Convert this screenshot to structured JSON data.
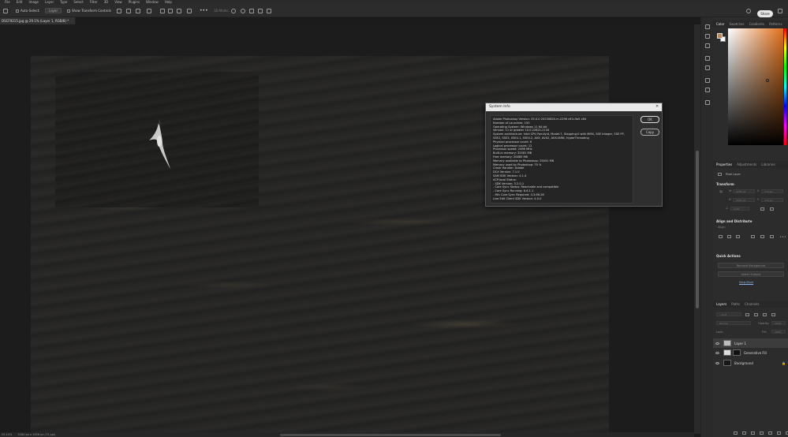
{
  "menubar": {
    "items": [
      "File",
      "Edit",
      "Image",
      "Layer",
      "Type",
      "Select",
      "Filter",
      "3D",
      "View",
      "Plugins",
      "Window",
      "Help"
    ]
  },
  "options_bar": {
    "auto_select_label": "Auto-Select:",
    "auto_select_value": "Layer",
    "show_transform_label": "Show Transform Controls",
    "mode_label": "3D Mode:",
    "share_label": "Share"
  },
  "document": {
    "tab_title": "DSCF9215.jpg @ 29.1% (Layer 1, RGB/8) *"
  },
  "status_bar": {
    "zoom": "29.14%",
    "info": "5184 px x 3456 px (72 ppi)"
  },
  "color_panel": {
    "tabs": [
      "Color",
      "Swatches",
      "Gradients",
      "Patterns"
    ],
    "active_tab": "Color",
    "fg_color": "#b88a5c",
    "bg_color": "#ffffff"
  },
  "properties_panel": {
    "tabs": [
      "Properties",
      "Adjustments",
      "Libraries"
    ],
    "active_tab": "Properties",
    "layer_type": "Pixel Layer",
    "transform_title": "Transform",
    "w_label": "W",
    "w_value": "2281 px",
    "x_label": "X",
    "x_value": "174 px",
    "h_label": "H",
    "h_value": "1521 px",
    "y_label": "Y",
    "y_value": "175 px",
    "angle_value": "0.00°",
    "align_title": "Align and Distribute",
    "align_label": "Align:",
    "quick_actions_title": "Quick Actions",
    "remove_bg_label": "Remove Background",
    "select_subject_label": "Select Subject",
    "view_more_label": "View More"
  },
  "layers_panel": {
    "tabs": [
      "Layers",
      "Paths",
      "Channels"
    ],
    "active_tab": "Layers",
    "kind_placeholder": "Kind",
    "blend_mode": "Normal",
    "opacity_label": "Opacity:",
    "opacity_value": "100%",
    "lock_label": "Lock:",
    "fill_label": "Fill:",
    "fill_value": "100%",
    "layers": [
      {
        "name": "Layer 1",
        "selected": true
      },
      {
        "name": "Generative Fill",
        "selected": false
      },
      {
        "name": "Background",
        "selected": false
      }
    ]
  },
  "dialog": {
    "title": "System Info",
    "ok_label": "OK",
    "copy_label": "Copy",
    "lines": [
      "Adobe Photoshop Version: 25.0.0 20230820.m.2296 c61c3a5  x64",
      "Number of Launches: 150",
      "Operating System: Windows 11 64-bit",
      "Version: 11 or greater 10.0.22621.2134",
      "System architecture: Intel CPU Family:6, Model:7, Stepping:0 with MMX, SSE Integer, SSE FP,",
      "SSE2, SSE3, SSE4.1, SSE4.2, AVX, AVX2, AVX-VNNI, HyperThreading",
      "Physical processor count: 6",
      "Logical processor count: 12",
      "Processor speed: 2496 MHz",
      "Built-in memory: 32581 MB",
      "Free memory: 20885 MB",
      "Memory available to Photoshop: 25041 MB",
      "Memory used by Photoshop: 70 %",
      "Crash Handler: Adobe",
      "DCX Version: 7.1.0",
      "SAM SDK Version: 4.1.4",
      "ACP.local Status:",
      "  - SDK Version: 3.2.0.1",
      "  - Core Sync Status: Reachable and compatible",
      "  - Core Sync Running: 6.6.1.1",
      "  - Min Core Sync Required: 4.3.66.28",
      "Live Edit Client SDK Version: 4.0.0"
    ]
  }
}
